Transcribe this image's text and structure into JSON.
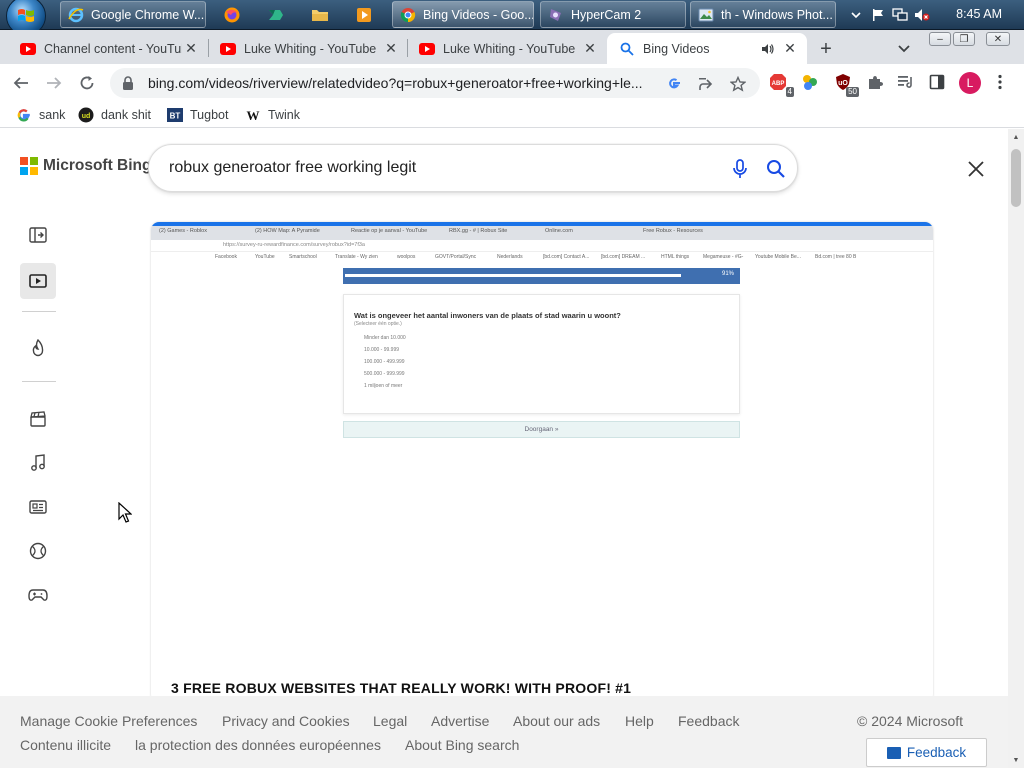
{
  "taskbar": {
    "tasks": [
      {
        "label": "Google Chrome W...",
        "icon": "ie-icon"
      },
      {
        "label": "",
        "icon": "firefox-icon"
      },
      {
        "label": "",
        "icon": "app-icon"
      },
      {
        "label": "",
        "icon": "folder-icon"
      },
      {
        "label": "",
        "icon": "media-player-icon"
      },
      {
        "label": "Bing Videos - Goo...",
        "icon": "chrome-icon"
      },
      {
        "label": "HyperCam 2",
        "icon": "hypercam-icon"
      },
      {
        "label": "th - Windows Phot...",
        "icon": "photo-viewer-icon"
      }
    ],
    "clock": "8:45 AM"
  },
  "browser": {
    "tabs": [
      {
        "title": "Channel content - YouTube",
        "favicon": "youtube-icon",
        "active": false
      },
      {
        "title": "Luke Whiting - YouTube",
        "favicon": "youtube-icon",
        "active": false
      },
      {
        "title": "Luke Whiting - YouTube",
        "favicon": "youtube-icon",
        "active": false
      },
      {
        "title": "Bing Videos",
        "favicon": "search-icon",
        "active": true
      }
    ],
    "url": "bing.com/videos/riverview/relatedvideo?q=robux+generoator+free+working+le...",
    "extension_badges": {
      "abp": "4",
      "ublock": "50"
    },
    "profile_initial": "L",
    "bookmarks": [
      {
        "label": "sank",
        "icon": "google-icon"
      },
      {
        "label": "dank shit",
        "icon": "ud-icon"
      },
      {
        "label": "Tugbot",
        "icon": "bt-icon"
      },
      {
        "label": "Twink",
        "icon": "w-icon"
      }
    ]
  },
  "bing": {
    "logo_text": "Microsoft Bing",
    "search_query": "robux generoator free working legit",
    "video": {
      "title": "3 FREE ROBUX WEBSITES THAT REALLY WORK! WITH PROOF! #1",
      "frame": {
        "progress_percent": "91%",
        "progress_fraction": 0.91,
        "question": "Wat is ongeveer het aantal inwoners van de plaats of stad waarin u woont?",
        "question_hint": "(Selecteer één optie.)",
        "options": [
          "Minder dan 10.000",
          "10.000 - 99.999",
          "100.000 - 499.999",
          "500.000 - 999.999",
          "1 miljoen of meer"
        ],
        "next_button": "Doorgaan »",
        "inner_tabs": [
          "(2) Games - Roblox",
          "(2) HOW Map: A Pyramide",
          "Reactie op je aanval - YouTube",
          "RBX.gg - # | Robux Site",
          "Online.com",
          "Free Robux - Resources"
        ],
        "inner_url": "https://survey-ru-rewardfinance.com/survey/robux?id=7f3a",
        "inner_bookmarks": [
          "Facebook",
          "YouTube",
          "Smartschool",
          "Translate - Wy zien",
          "woolpos",
          "GOVT/Portal/Sync",
          "Nederlands",
          "[bd.com] Contact A...",
          "[bd.com] DREAM ...",
          "HTML things",
          "Megameuse - #G-",
          "Youtube Mobile Be...",
          "Bd.com | tree 80 B"
        ]
      }
    },
    "footer": {
      "row1": [
        "Manage Cookie Preferences",
        "Privacy and Cookies",
        "Legal",
        "Advertise",
        "About our ads",
        "Help",
        "Feedback"
      ],
      "copyright": "© 2024 Microsoft",
      "row2": [
        "Contenu illicite",
        "la protection des données européennes",
        "About Bing search"
      ],
      "feedback_button": "Feedback"
    }
  },
  "colors": {
    "accent": "#1a73e8",
    "youtube_red": "#ff0000",
    "bing_link_blue": "#1a5fb4",
    "profile_pink": "#d81b60"
  }
}
